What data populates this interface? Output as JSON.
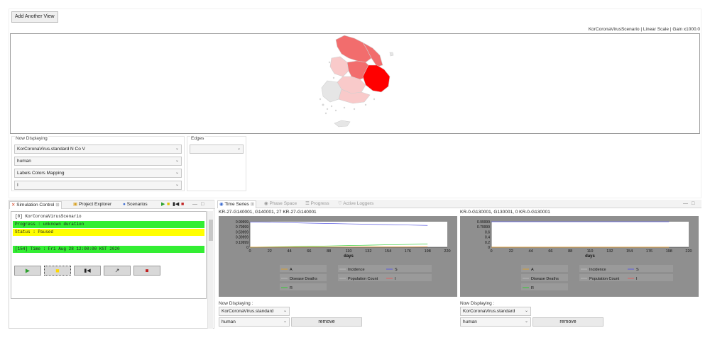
{
  "toolbar": {
    "add_view_label": "Add Another View"
  },
  "map_view": {
    "caption": "KorCoronaVirusScenario | Linear Scale | Gain x1000.0",
    "colors": {
      "high": "#ff0000",
      "mid": "#f26d6d",
      "low": "#f9caca",
      "none": "#e6e6e6",
      "outline": "#cfcfcf"
    }
  },
  "display_controls": {
    "now_displaying_title": "Now Displaying",
    "scenario_combo": "KorCoronaVirus.standard N Co V",
    "population_combo": "human",
    "mapping_combo": "Labels Colors Mapping",
    "state_combo": "I",
    "edges_title": "Edges",
    "edges_combo": ""
  },
  "left_panel": {
    "tabs": {
      "simulation_control": "Simulation Control",
      "project_explorer": "Project Explorer",
      "scenarios": "Scenarios"
    },
    "scenario_line": "[0] KorCoronaVirusScenario",
    "progress_line": "Progress : unknown duration",
    "status_line": "Status : Paused",
    "time_line": "[154] Time : Fri Aug 28 12:00:00 KST 2020",
    "colors": {
      "green": "#33ee33",
      "yellow": "#ffff00"
    },
    "buttons": [
      "run",
      "pause",
      "step-back",
      "reset",
      "stop"
    ]
  },
  "right_panel": {
    "tabs": {
      "time_series": "Time Series",
      "phase_space": "Phase Space",
      "progress": "Progress",
      "active_loggers": "Active Loggers"
    },
    "views": [
      {
        "caption": "KR-27-G140001, G140001, 27 KR-27-G140001",
        "now_label": "Now Displaying :",
        "scenario_value": "KorCoronaVirus.standard",
        "population_value": "human",
        "remove_label": "remove",
        "chart_data": {
          "type": "line",
          "xlabel": "days",
          "xlim": [
            0,
            220
          ],
          "x_ticks": [
            "0",
            "22",
            "44",
            "66",
            "88",
            "110",
            "132",
            "154",
            "176",
            "198",
            "220"
          ],
          "y_ticks": [
            "0",
            "0.19999",
            "0.39999",
            "0.59999",
            "0.79999",
            "0.99999"
          ],
          "ylim": [
            0,
            1
          ],
          "legend": [
            "A",
            "Incidence",
            "S",
            "Disease Deaths",
            "Population Count",
            "I",
            "R"
          ],
          "series": [
            {
              "name": "S",
              "color": "#5a5ae0",
              "x": [
                0,
                22,
                44,
                66,
                88,
                110,
                132,
                154,
                176,
                198
              ],
              "y": [
                0.99,
                0.975,
                0.96,
                0.945,
                0.93,
                0.915,
                0.9,
                0.885,
                0.87,
                0.855
              ]
            },
            {
              "name": "R",
              "color": "#33cc33",
              "x": [
                0,
                22,
                44,
                66,
                88,
                110,
                132,
                154,
                176,
                198
              ],
              "y": [
                0,
                0.01,
                0.02,
                0.035,
                0.05,
                0.065,
                0.08,
                0.095,
                0.11,
                0.125
              ]
            },
            {
              "name": "I",
              "color": "#e06060",
              "x": [
                0,
                44,
                88,
                132,
                176,
                198
              ],
              "y": [
                0.004,
                0.006,
                0.008,
                0.01,
                0.012,
                0.013
              ]
            },
            {
              "name": "A",
              "color": "#d9a030",
              "x": [
                0,
                44,
                88,
                132,
                176,
                198
              ],
              "y": [
                0.003,
                0.004,
                0.005,
                0.006,
                0.007,
                0.008
              ]
            }
          ]
        }
      },
      {
        "caption": "KR-0-G130001, G130001, 0 KR-0-G130001",
        "now_label": "Now Displaying :",
        "scenario_value": "KorCoronaVirus.standard",
        "population_value": "human",
        "remove_label": "remove",
        "chart_data": {
          "type": "line",
          "xlabel": "days",
          "xlim": [
            0,
            220
          ],
          "x_ticks": [
            "0",
            "22",
            "44",
            "66",
            "88",
            "110",
            "132",
            "154",
            "176",
            "198",
            "220"
          ],
          "y_ticks": [
            "0",
            "0.2",
            "0.4",
            "0.6",
            "0.79999",
            "0.99999"
          ],
          "ylim": [
            0,
            1
          ],
          "legend": [
            "A",
            "Incidence",
            "S",
            "Disease Deaths",
            "Population Count",
            "I",
            "R"
          ],
          "series": [
            {
              "name": "S",
              "color": "#5a5ae0",
              "x": [
                0,
                44,
                88,
                132,
                176,
                198
              ],
              "y": [
                0.9999,
                0.9999,
                0.9998,
                0.9998,
                0.9997,
                0.9997
              ]
            },
            {
              "name": "R",
              "color": "#33cc33",
              "x": [
                0,
                44,
                88,
                132,
                176,
                198
              ],
              "y": [
                0,
                0,
                0.0001,
                0.0001,
                0.0002,
                0.0002
              ]
            },
            {
              "name": "I",
              "color": "#e06060",
              "x": [
                0,
                44,
                88,
                132,
                176,
                198
              ],
              "y": [
                0,
                0,
                0,
                0,
                0,
                0
              ]
            },
            {
              "name": "A",
              "color": "#d9a030",
              "x": [
                0,
                44,
                88,
                132,
                176,
                198
              ],
              "y": [
                0,
                0,
                0,
                0,
                0,
                0
              ]
            }
          ]
        }
      }
    ]
  }
}
